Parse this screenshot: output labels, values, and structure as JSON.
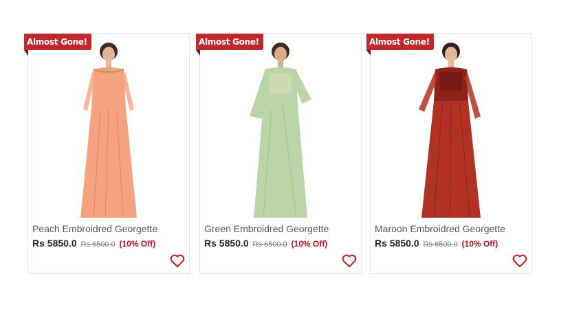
{
  "products": [
    {
      "badge": "Almost Gone!",
      "title": "Peach Embroidred Georgette",
      "price": "Rs 5850.0",
      "mrp": "Rs 6500.0",
      "discount": "(10% Off)",
      "dress_color": "#f4a37e",
      "accent_color": "#d88a66"
    },
    {
      "badge": "Almost Gone!",
      "title": "Green Embroidred Georgette",
      "price": "Rs 5850.0",
      "mrp": "Rs 6500.0",
      "discount": "(10% Off)",
      "dress_color": "#b9d5a8",
      "accent_color": "#a3c192"
    },
    {
      "badge": "Almost Gone!",
      "title": "Maroon Embroidred Georgette",
      "price": "Rs 5850.0",
      "mrp": "Rs 6500.0",
      "discount": "(10% Off)",
      "dress_color": "#b23125",
      "accent_color": "#8f2219"
    }
  ],
  "colors": {
    "badge": "#c1272d",
    "discount": "#b3121d",
    "heart": "#c1272d"
  },
  "icons": {
    "wishlist": "heart-outline-icon"
  }
}
